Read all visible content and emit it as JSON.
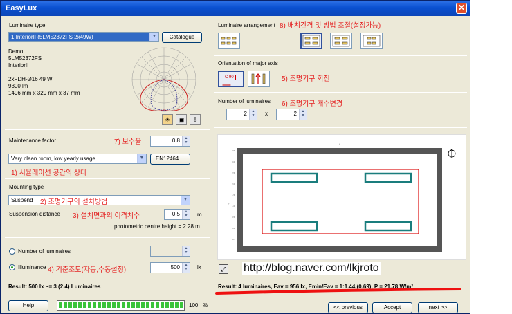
{
  "window": {
    "title": "EasyLux"
  },
  "left": {
    "luminaire_type": {
      "label": "Luminaire type",
      "selected": "1     InteriorII (5LM52372FS 2x49W)",
      "catalogue": "Catalogue"
    },
    "info": [
      "Demo",
      "5LM52372FS",
      "InteriorII",
      "",
      "2xFDH-Ø16 49 W",
      "9300 lm",
      "1496 mm x 329 mm x 37 mm"
    ],
    "maintenance": {
      "label": "Maintenance factor",
      "annotation": "7) 보수율",
      "value": "0.8",
      "room": "Very clean room, low yearly usage",
      "standard": "EN12464 ...",
      "room_annotation": "1) 시뮬레이션 공간의 상태"
    },
    "mounting": {
      "label": "Mounting type",
      "value": "Suspend",
      "annotation": "2) 조명기구의 설치방법",
      "suspension_label": "Suspension distance",
      "suspension_annotation": "3) 설치면과의 이격치수",
      "suspension_value": "0.5",
      "unit": "m",
      "photometric": "photometric centre height = 2.28 m"
    },
    "calc": {
      "number_label": "Number of luminaires",
      "illuminance_label": "Illuminance",
      "illuminance_annotation": "4) 기준조도(자동,수동설정)",
      "illuminance_value": "500",
      "unit": "lx"
    },
    "result": "Result: 500 lx ~= 3 (2.4) Luminaires"
  },
  "right": {
    "arrangement": {
      "label": "Luminaire arrangement",
      "annotation": "8) 배치간격 및 방법 조절(설정가능)"
    },
    "orientation": {
      "label": "Orientation of major axis",
      "annotation": "5) 조명기구 회전",
      "rotate_label": "C 90"
    },
    "number": {
      "label": "Number of luminaires",
      "annotation": "6) 조명기구 개수변경",
      "nx": "2",
      "times": "x",
      "ny": "2"
    },
    "preview": {
      "url": "http://blog.naver.com/lkjroto"
    },
    "result": "Result: 4 luminaires, Eav = 956 lx, Emin/Eav = 1:1.44 (0.69), P = 21.78 W/m²"
  },
  "footer": {
    "help": "Help",
    "progress": 1.0,
    "progress_text": "100",
    "percent": "%",
    "previous": "<< previous",
    "accept": "Accept",
    "next": "next >>"
  }
}
